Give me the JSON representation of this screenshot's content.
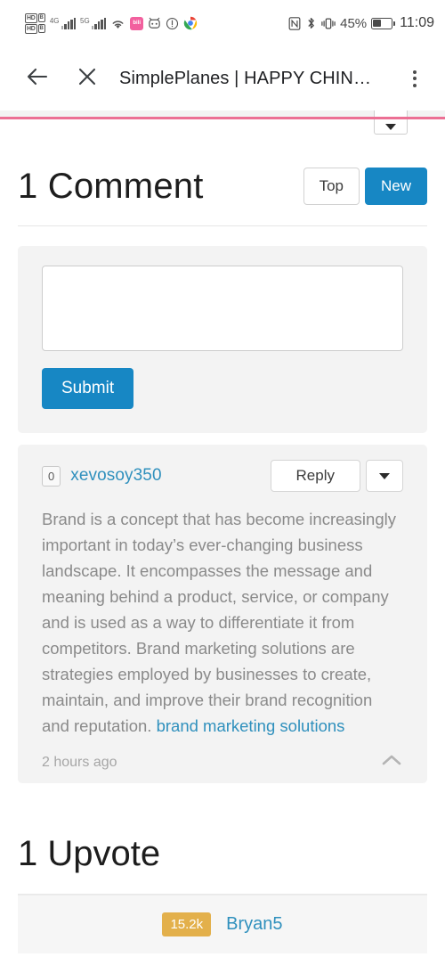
{
  "status_bar": {
    "hd_label": "HD",
    "hd_sub": "B",
    "network_4g": "4G",
    "network_5g": "5G",
    "icons": [
      "hd-voice-icon",
      "hd-voice-icon",
      "signal-4g-icon",
      "signal-5g-icon",
      "wifi-icon",
      "bilibili-app-icon",
      "tv-app-icon",
      "info-circle-icon",
      "chrome-icon",
      "nfc-icon",
      "bluetooth-icon",
      "vibrate-icon"
    ],
    "bilibili_label": "bili",
    "battery_percent": "45%",
    "clock": "11:09"
  },
  "toolbar": {
    "back_icon": "arrow-left-icon",
    "close_icon": "close-icon",
    "title": "SimplePlanes | HAPPY CHIN…",
    "menu_icon": "kebab-menu-icon"
  },
  "page": {
    "progress_color": "#ec7094",
    "accent_blue": "#1787c4",
    "link_blue": "#2f90bd",
    "badge_gold": "#e3b04b",
    "partial_dropdown_icon": "caret-down-icon"
  },
  "comments_section": {
    "title": "1 Comment",
    "sort": {
      "top_label": "Top",
      "new_label": "New",
      "selected": "New"
    },
    "form": {
      "textarea_value": "",
      "textarea_placeholder": "",
      "submit_label": "Submit"
    },
    "comments": [
      {
        "score": "0",
        "username": "xevosoy350",
        "reply_label": "Reply",
        "more_icon": "caret-down-icon",
        "body_text": "Brand is a concept that has become increasingly important in today’s ever-changing business landscape. It encompasses the message and meaning behind a product, service, or company and is used as a way to differentiate it from competitors. Brand marketing solutions are strategies employed by businesses to create, maintain, and improve their brand recognition and reputation. ",
        "body_link": "brand marketing solutions",
        "timestamp": "2 hours ago",
        "collapse_icon": "chevron-up-icon"
      }
    ]
  },
  "upvotes_section": {
    "title": "1 Upvote",
    "upvoters": [
      {
        "points": "15.2k",
        "username": "Bryan5"
      }
    ]
  }
}
